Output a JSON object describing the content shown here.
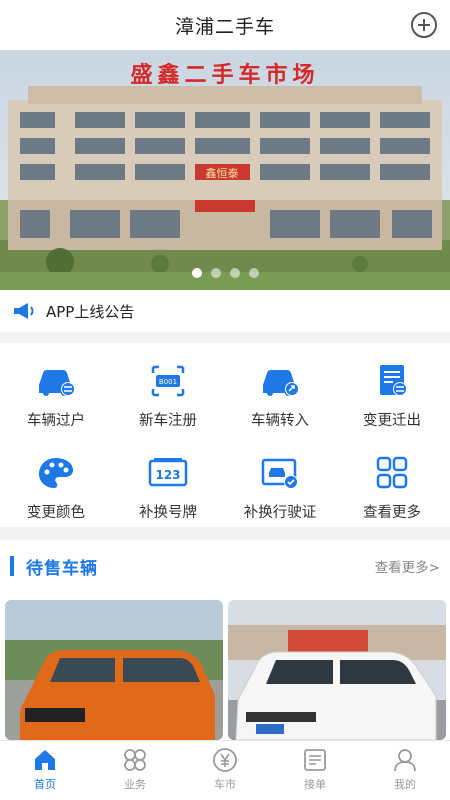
{
  "header": {
    "title": "漳浦二手车",
    "add_icon": "plus-circle-icon"
  },
  "banner": {
    "sign_text": "盛鑫二手车市场",
    "facade_text": "鑫恒泰",
    "slides": 4,
    "active_slide": 0
  },
  "notice": {
    "icon": "megaphone-icon",
    "text": "APP上线公告"
  },
  "services": [
    {
      "label": "车辆过户",
      "icon": "car-transfer-icon"
    },
    {
      "label": "新车注册",
      "icon": "plate-scan-icon"
    },
    {
      "label": "车辆转入",
      "icon": "car-import-icon"
    },
    {
      "label": "变更迁出",
      "icon": "document-transfer-icon"
    },
    {
      "label": "变更颜色",
      "icon": "palette-icon"
    },
    {
      "label": "补换号牌",
      "icon": "number-plate-icon"
    },
    {
      "label": "补换行驶证",
      "icon": "license-card-icon"
    },
    {
      "label": "查看更多",
      "icon": "grid-icon"
    }
  ],
  "for_sale": {
    "title": "待售车辆",
    "more": "查看更多>",
    "cars": [
      {
        "color": "#e06a1a"
      },
      {
        "color": "#ffffff"
      }
    ]
  },
  "tabs": [
    {
      "label": "首页",
      "icon": "home-icon",
      "active": true
    },
    {
      "label": "业务",
      "icon": "business-icon",
      "active": false
    },
    {
      "label": "车市",
      "icon": "yuan-icon",
      "active": false
    },
    {
      "label": "接单",
      "icon": "order-icon",
      "active": false
    },
    {
      "label": "我的",
      "icon": "user-icon",
      "active": false
    }
  ],
  "colors": {
    "accent": "#1e78e6",
    "inactive": "#999999"
  }
}
